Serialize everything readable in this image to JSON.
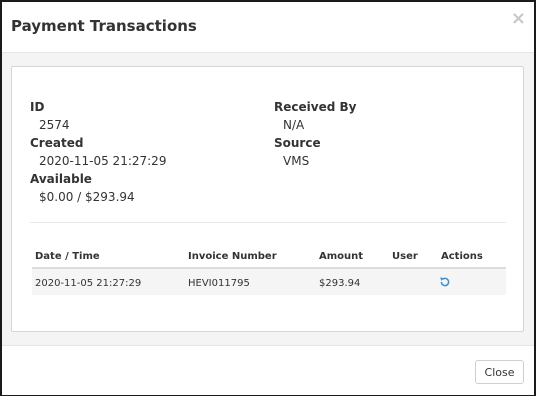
{
  "dialog": {
    "title": "Payment Transactions",
    "close_icon": "×"
  },
  "details": {
    "id_label": "ID",
    "id_value": "2574",
    "created_label": "Created",
    "created_value": "2020-11-05 21:27:29",
    "available_label": "Available",
    "available_value": "$0.00 / $293.94",
    "received_by_label": "Received By",
    "received_by_value": "N/A",
    "source_label": "Source",
    "source_value": "VMS"
  },
  "table": {
    "headers": [
      "Date / Time",
      "Invoice Number",
      "Amount",
      "User",
      "Actions"
    ],
    "rows": [
      {
        "date_time": "2020-11-05 21:27:29",
        "invoice_number": "HEVI011795",
        "amount": "$293.94",
        "user": "",
        "action_icon": "refresh-icon"
      }
    ]
  },
  "footer": {
    "close_label": "Close"
  },
  "colors": {
    "accent": "#3a8fd0"
  }
}
